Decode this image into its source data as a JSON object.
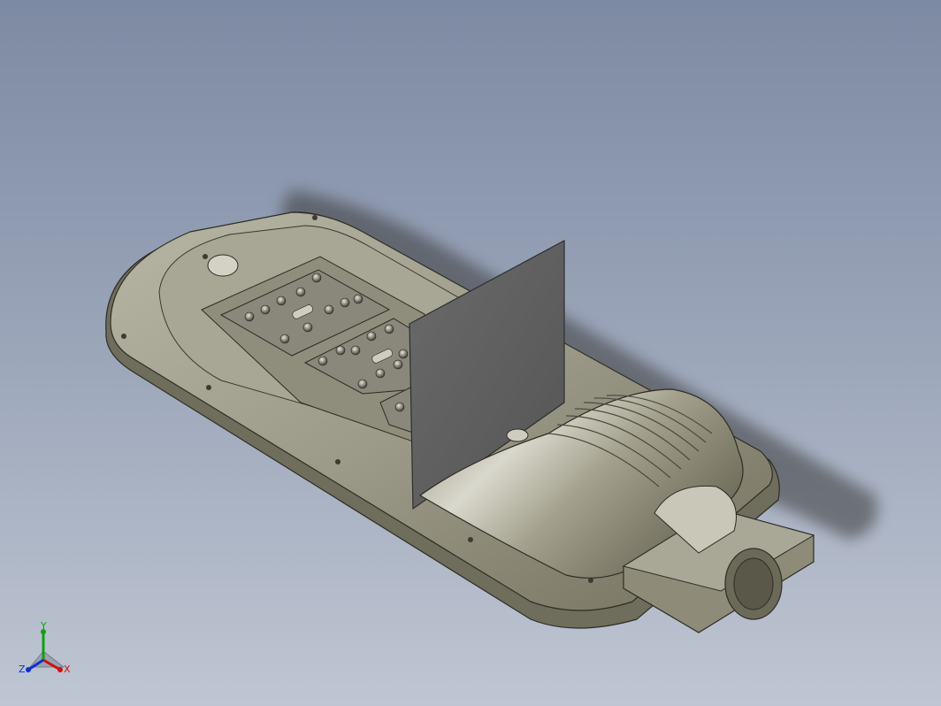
{
  "viewport": {
    "background_top": "#7d8aa3",
    "background_bottom": "#bfc6d3"
  },
  "model": {
    "housing_color": "#9c9a88",
    "housing_dark": "#5a594f",
    "panel_color": "#5f5f5f",
    "led_module_count": 3
  },
  "triad": {
    "x_label": "X",
    "y_label": "Y",
    "z_label": "Z",
    "x_color": "#d01010",
    "y_color": "#10a010",
    "z_color": "#1030d0"
  }
}
